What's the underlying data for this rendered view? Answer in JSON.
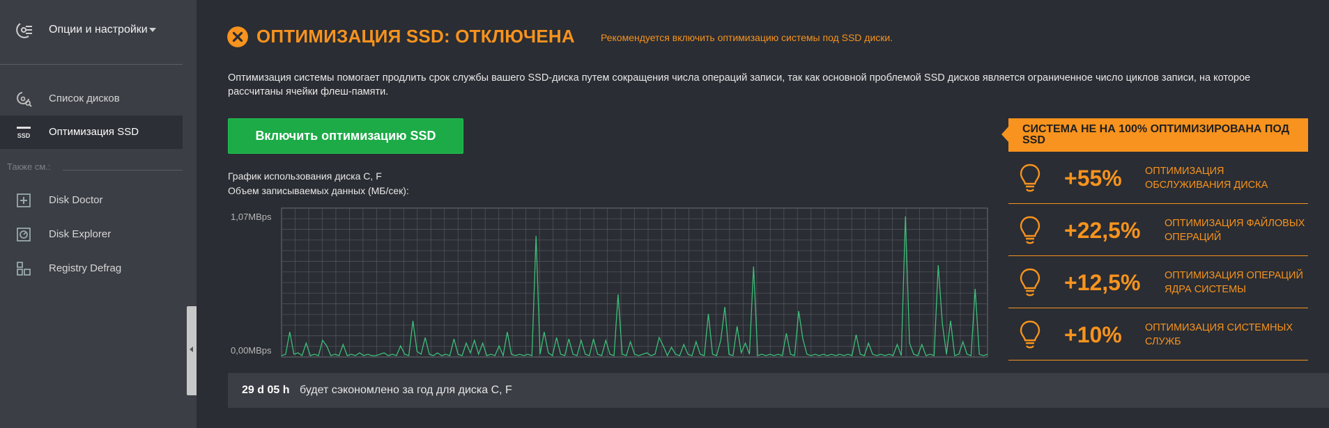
{
  "sidebar": {
    "options_label": "Опции и настройки",
    "items": [
      {
        "label": "Список дисков",
        "icon": "disk-search-icon"
      },
      {
        "label": "Оптимизация SSD",
        "icon": "ssd-icon",
        "icon_text": "SSD",
        "active": true
      }
    ],
    "see_also_label": "Также см.:",
    "see_also": [
      {
        "label": "Disk Doctor",
        "icon": "disk-doctor-icon"
      },
      {
        "label": "Disk Explorer",
        "icon": "disk-explorer-icon"
      },
      {
        "label": "Registry Defrag",
        "icon": "registry-defrag-icon"
      }
    ]
  },
  "header": {
    "title": "ОПТИМИЗАЦИЯ SSD: ОТКЛЮЧЕНА",
    "recommendation": "Рекомендуется включить оптимизацию системы под SSD диски.",
    "status_icon": "close-circle-icon"
  },
  "description": "Оптимизация системы помогает продлить срок службы вашего SSD-диска путем сокращения числа операций записи, так как основной проблемой SSD дисков является ограниченное число циклов записи, на которое рассчитаны ячейки флеш-памяти.",
  "enable_button": "Включить оптимизацию SSD",
  "chart_title_1": "График использования диска C, F",
  "chart_title_2": "Объем записываемых данных (МБ/сек):",
  "chart_data": {
    "type": "line",
    "y_max_label": "1,07MBps",
    "y_min_label": "0,00MBps",
    "ylim": [
      0,
      1.07
    ],
    "grid": true,
    "color": "#3dbf7a",
    "values": [
      0.01,
      0.02,
      0.18,
      0.02,
      0.03,
      0.01,
      0.1,
      0.01,
      0.02,
      0.01,
      0.12,
      0.08,
      0.01,
      0.02,
      0.01,
      0.09,
      0.01,
      0.02,
      0.01,
      0.03,
      0.01,
      0.02,
      0.01,
      0.01,
      0.02,
      0.03,
      0.01,
      0.02,
      0.01,
      0.08,
      0.02,
      0.01,
      0.26,
      0.04,
      0.02,
      0.14,
      0.02,
      0.01,
      0.03,
      0.01,
      0.02,
      0.01,
      0.13,
      0.02,
      0.01,
      0.1,
      0.03,
      0.12,
      0.02,
      0.1,
      0.01,
      0.02,
      0.01,
      0.08,
      0.01,
      0.18,
      0.02,
      0.01,
      0.02,
      0.01,
      0.02,
      0.01,
      0.87,
      0.02,
      0.18,
      0.03,
      0.01,
      0.14,
      0.02,
      0.01,
      0.13,
      0.02,
      0.01,
      0.12,
      0.02,
      0.01,
      0.13,
      0.02,
      0.01,
      0.12,
      0.02,
      0.01,
      0.45,
      0.02,
      0.01,
      0.11,
      0.02,
      0.01,
      0.02,
      0.03,
      0.01,
      0.02,
      0.14,
      0.08,
      0.01,
      0.07,
      0.02,
      0.01,
      0.09,
      0.02,
      0.01,
      0.11,
      0.02,
      0.01,
      0.31,
      0.02,
      0.01,
      0.12,
      0.36,
      0.02,
      0.01,
      0.22,
      0.03,
      0.1,
      0.02,
      0.65,
      0.01,
      0.02,
      0.01,
      0.02,
      0.01,
      0.02,
      0.01,
      0.17,
      0.02,
      0.01,
      0.33,
      0.13,
      0.02,
      0.01,
      0.02,
      0.01,
      0.02,
      0.01,
      0.02,
      0.01,
      0.02,
      0.01,
      0.02,
      0.01,
      0.16,
      0.02,
      0.01,
      0.1,
      0.02,
      0.01,
      0.02,
      0.01,
      0.02,
      0.01,
      0.09,
      0.01,
      1.01,
      0.1,
      0.02,
      0.01,
      0.09,
      0.01,
      0.02,
      0.01,
      0.66,
      0.24,
      0.02,
      0.26,
      0.01,
      0.02,
      0.11,
      0.02,
      0.01,
      0.49,
      0.02,
      0.01,
      0.02
    ]
  },
  "right_panel": {
    "banner": "СИСТЕМА НЕ НА 100% ОПТИМИЗИРОВАНА ПОД SSD",
    "stats": [
      {
        "pct": "+55%",
        "label_1": "ОПТИМИЗАЦИЯ",
        "label_2": "ОБСЛУЖИВАНИЯ ДИСКА"
      },
      {
        "pct": "+22,5%",
        "label_1": "ОПТИМИЗАЦИЯ ФАЙЛОВЫХ",
        "label_2": "ОПЕРАЦИЙ"
      },
      {
        "pct": "+12,5%",
        "label_1": "ОПТИМИЗАЦИЯ ОПЕРАЦИЙ",
        "label_2": "ЯДРА СИСТЕМЫ"
      },
      {
        "pct": "+10%",
        "label_1": "ОПТИМИЗАЦИЯ СИСТЕМНЫХ",
        "label_2": "СЛУЖБ"
      }
    ],
    "stat_icon": "lightbulb-icon"
  },
  "savings": {
    "value": "29 d 05 h",
    "text": "будет сэкономлено за год для диска C, F"
  },
  "colors": {
    "accent": "#f7931e",
    "button": "#1cab47",
    "chart_line": "#3dbf7a"
  }
}
